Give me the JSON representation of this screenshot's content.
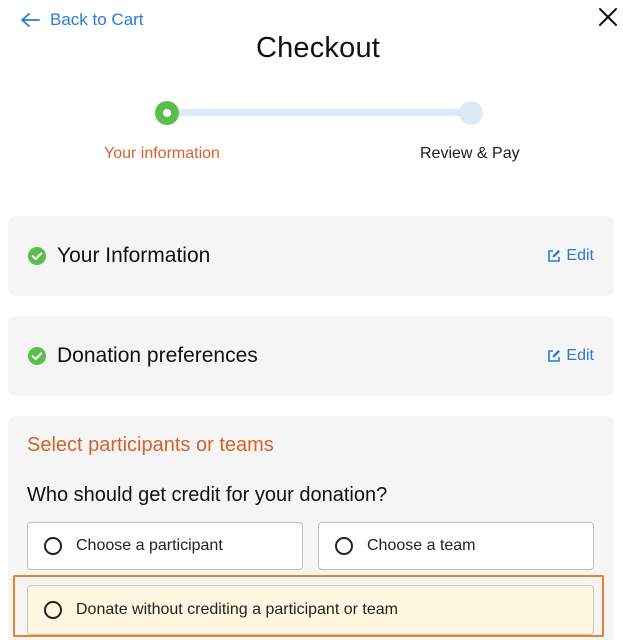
{
  "header": {
    "back_label": "Back to Cart",
    "title": "Checkout"
  },
  "stepper": {
    "steps": [
      {
        "label": "Your information",
        "state": "active"
      },
      {
        "label": "Review & Pay",
        "state": "upcoming"
      }
    ]
  },
  "sections": {
    "your_information": {
      "title": "Your Information",
      "edit_label": "Edit",
      "completed": true
    },
    "donation_preferences": {
      "title": "Donation preferences",
      "edit_label": "Edit",
      "completed": true
    },
    "select_participants": {
      "title": "Select participants or teams",
      "question": "Who should get credit for your donation?",
      "options": [
        {
          "label": "Choose a participant",
          "selected": false
        },
        {
          "label": "Choose a team",
          "selected": false
        },
        {
          "label": "Donate without crediting a participant or team",
          "selected": false,
          "highlighted": true
        }
      ]
    }
  },
  "colors": {
    "accent_blue": "#2a7bd4",
    "accent_orange": "#d4622a",
    "success_green": "#5cbd4e",
    "highlight_border": "#e8822c"
  },
  "icons": {
    "back": "arrow-left-icon",
    "close": "close-icon",
    "check": "check-circle-icon",
    "edit": "edit-icon"
  }
}
